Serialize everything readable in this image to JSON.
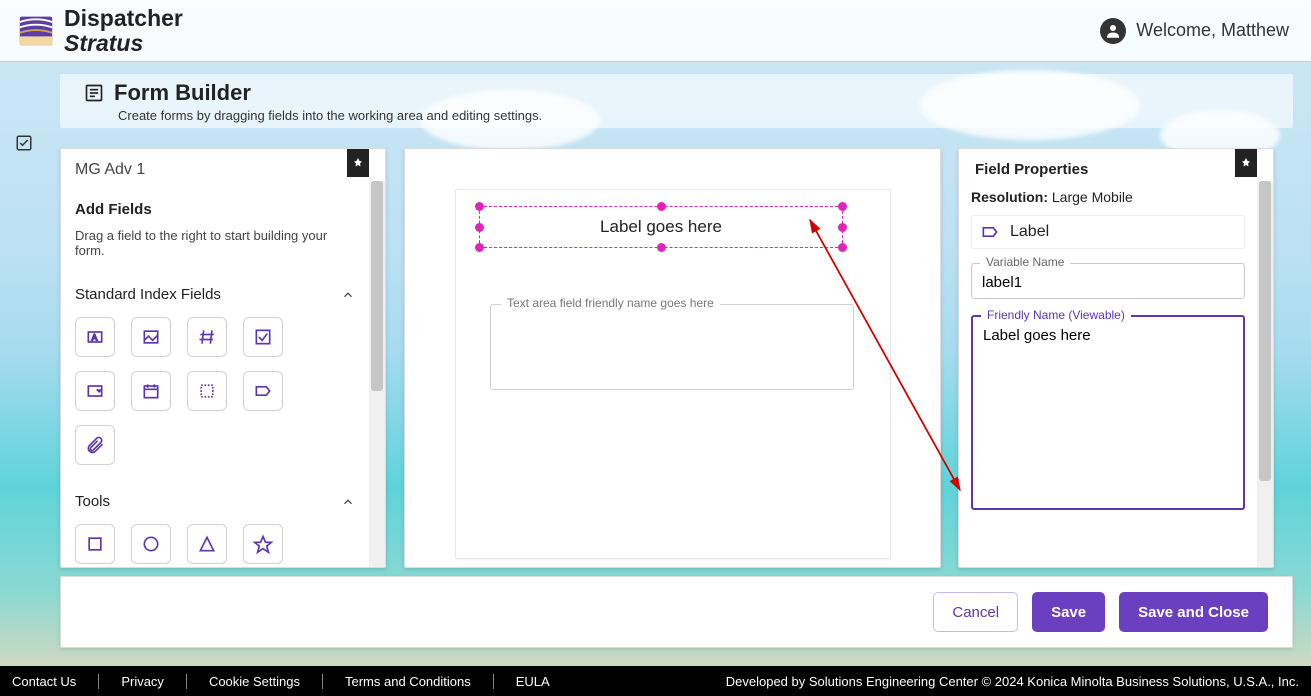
{
  "brand": {
    "line1": "Dispatcher",
    "line2": "Stratus"
  },
  "welcome": {
    "text": "Welcome, Matthew"
  },
  "page": {
    "title": "Form Builder",
    "subtitle": "Create forms by dragging fields into the working area and editing settings."
  },
  "left_panel": {
    "form_name": "MG Adv 1",
    "add_fields_title": "Add Fields",
    "add_fields_hint": "Drag a field to the right to start building your form.",
    "section_standard": "Standard Index Fields",
    "section_tools": "Tools"
  },
  "canvas": {
    "label_text": "Label goes here",
    "textarea_legend": "Text area field friendly name goes here"
  },
  "right_panel": {
    "title": "Field Properties",
    "resolution_label": "Resolution:",
    "resolution_value": "Large Mobile",
    "type_label": "Label",
    "variable_name_legend": "Variable Name",
    "variable_name_value": "label1",
    "friendly_name_legend": "Friendly Name (Viewable)",
    "friendly_name_value": "Label goes here"
  },
  "actions": {
    "cancel": "Cancel",
    "save": "Save",
    "save_close": "Save and Close"
  },
  "footer": {
    "links": [
      "Contact Us",
      "Privacy",
      "Cookie Settings",
      "Terms and Conditions",
      "EULA"
    ],
    "right_text": "Developed by Solutions Engineering Center © 2024 Konica Minolta Business Solutions, U.S.A., Inc."
  }
}
